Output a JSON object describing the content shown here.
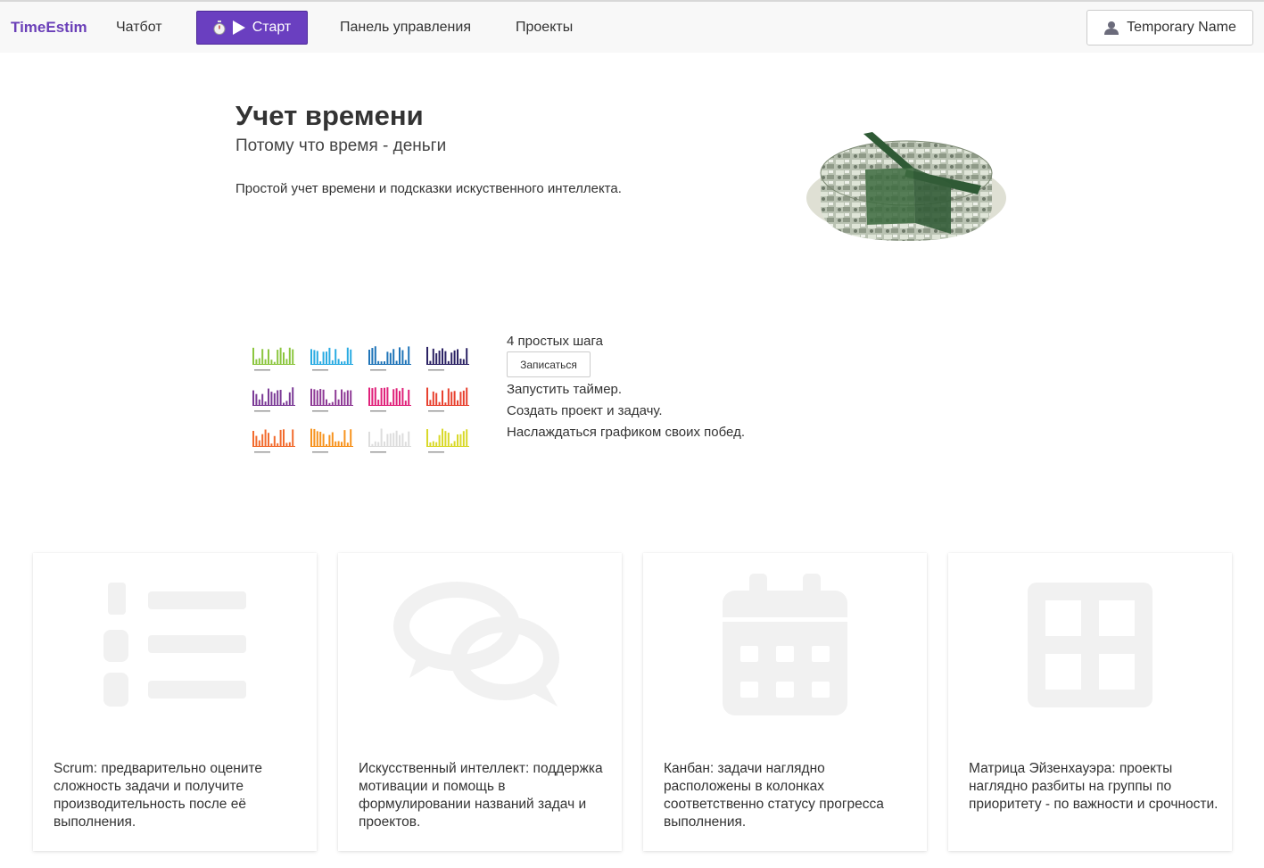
{
  "navbar": {
    "brand": "TimeEstim",
    "links": [
      "Чатбот",
      "Панель управления",
      "Проекты"
    ],
    "start_label": "Старт",
    "user_name": "Temporary Name"
  },
  "hero": {
    "title": "Учет времени",
    "subtitle": "Потому что время - деньги",
    "description": "Простой учет времени и подсказки искуственного интеллекта."
  },
  "steps": {
    "title": "4 простых шага",
    "signup_label": "Записаться",
    "items": [
      "Запустить таймер.",
      "Создать проект и задачу.",
      "Наслаждаться графиком своих побед."
    ]
  },
  "mini_chart_colors": [
    "#8cc63f",
    "#29abe2",
    "#1f74b8",
    "#2b2264",
    "#7b3a96",
    "#8e3a96",
    "#e0217a",
    "#e8412f",
    "#f26b2e",
    "#f7931e",
    "#dddddd",
    "#d9d92a"
  ],
  "features": [
    {
      "icon": "numbered-list-icon",
      "text": "Scrum: предварительно оцените сложность задачи и получите производительность после её выполнения."
    },
    {
      "icon": "chat-bubbles-icon",
      "text": "Искусственный интеллект: поддержка мотивации и помощь в формулировании названий задач и проектов."
    },
    {
      "icon": "calendar-icon",
      "text": "Канбан: задачи наглядно расположены в колонках соответственно статусу прогресса выполнения."
    },
    {
      "icon": "grid-icon",
      "text": "Матрица Эйзенхауэра: проекты наглядно разбиты на группы по приоритету - по важности и срочности."
    }
  ]
}
